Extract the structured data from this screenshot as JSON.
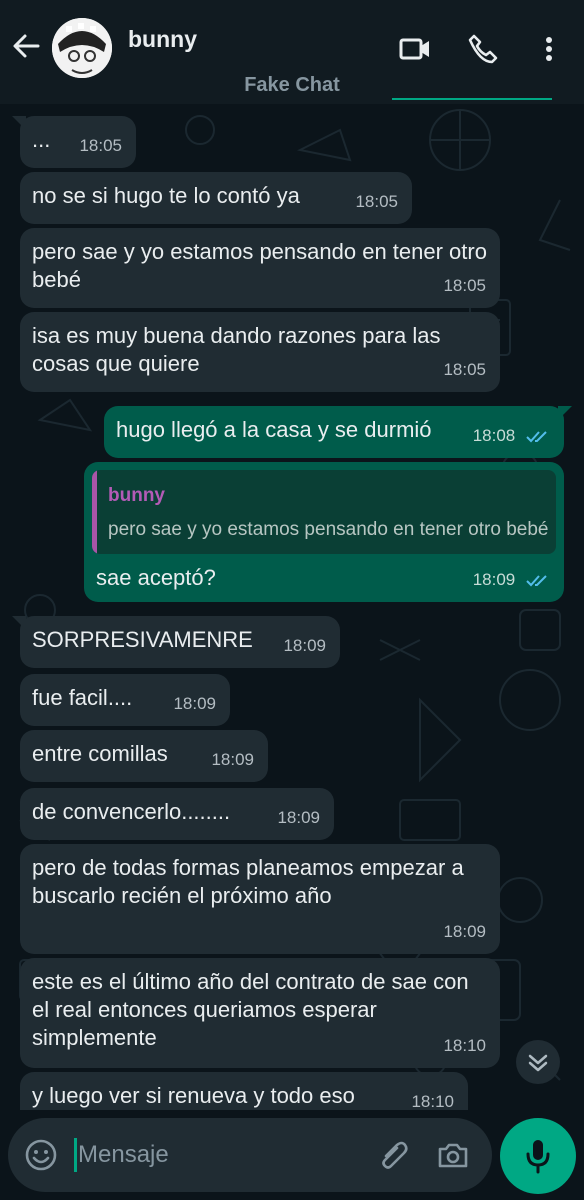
{
  "header": {
    "contact_name": "bunny",
    "subtitle": "Fake Chat"
  },
  "input": {
    "placeholder": "Mensaje"
  },
  "messages": [
    {
      "dir": "in",
      "text": "...",
      "time": "18:05"
    },
    {
      "dir": "in",
      "text": "no se si hugo te lo contó ya",
      "time": "18:05"
    },
    {
      "dir": "in",
      "text": "pero sae y yo estamos pensando en tener otro bebé",
      "time": "18:05"
    },
    {
      "dir": "in",
      "text": "isa es muy buena dando razones para las cosas que quiere",
      "time": "18:05"
    },
    {
      "dir": "out",
      "text": "hugo llegó a la casa y se durmió",
      "time": "18:08",
      "status": "read"
    },
    {
      "dir": "out",
      "text": "sae aceptó?",
      "time": "18:09",
      "status": "read",
      "quote": {
        "author": "bunny",
        "text": "pero sae y yo estamos pensando en tener otro bebé"
      }
    },
    {
      "dir": "in",
      "text": "SORPRESIVAMENRE",
      "time": "18:09"
    },
    {
      "dir": "in",
      "text": "fue facil....",
      "time": "18:09"
    },
    {
      "dir": "in",
      "text": "entre comillas",
      "time": "18:09"
    },
    {
      "dir": "in",
      "text": "de convencerlo........",
      "time": "18:09"
    },
    {
      "dir": "in",
      "text": "pero de todas formas planeamos empezar a buscarlo recién el próximo año",
      "time": "18:09"
    },
    {
      "dir": "in",
      "text": "este es el último año del contrato de sae con el real entonces queriamos esperar simplemente",
      "time": "18:10"
    },
    {
      "dir": "in",
      "text": "y luego ver si renueva y todo eso",
      "time": "18:10"
    }
  ],
  "colors": {
    "background": "#0b141a",
    "incoming_bubble": "#202c33",
    "outgoing_bubble": "#005c4b",
    "accent": "#00a884",
    "read_ticks": "#53bdeb",
    "quote_author": "#b35bb6"
  },
  "icons": [
    "back-arrow-icon",
    "video-call-icon",
    "phone-icon",
    "more-options-icon",
    "emoji-icon",
    "attach-icon",
    "camera-icon",
    "microphone-icon",
    "chevron-down-icon",
    "double-check-icon"
  ]
}
